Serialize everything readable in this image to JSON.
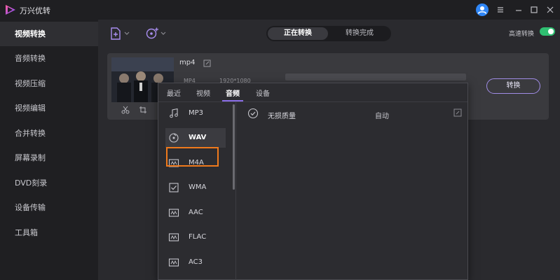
{
  "app": {
    "title": "万兴优转"
  },
  "sidebar": {
    "items": [
      {
        "label": "视频转换",
        "active": true
      },
      {
        "label": "音频转换"
      },
      {
        "label": "视频压缩"
      },
      {
        "label": "视频编辑"
      },
      {
        "label": "合并转换"
      },
      {
        "label": "屏幕录制"
      },
      {
        "label": "DVD刻录"
      },
      {
        "label": "设备传输"
      },
      {
        "label": "工具箱"
      }
    ]
  },
  "toolbar": {
    "tabs": [
      {
        "label": "正在转换",
        "active": true
      },
      {
        "label": "转换完成"
      }
    ],
    "high_speed_label": "高速转换",
    "high_speed_on": true
  },
  "file": {
    "name": "mp4",
    "format": "MP4",
    "resolution": "1920*1080",
    "convert_label": "转换"
  },
  "dropdown": {
    "tabs": [
      {
        "label": "最近"
      },
      {
        "label": "视频"
      },
      {
        "label": "音频",
        "active": true
      },
      {
        "label": "设备"
      }
    ],
    "formats": [
      {
        "label": "MP3",
        "icon": "music-note-icon"
      },
      {
        "label": "WAV",
        "icon": "disc-icon",
        "selected": true
      },
      {
        "label": "M4A",
        "icon": "audio-file-icon"
      },
      {
        "label": "WMA",
        "icon": "check-file-icon"
      },
      {
        "label": "AAC",
        "icon": "audio-file-icon"
      },
      {
        "label": "FLAC",
        "icon": "audio-file-icon"
      },
      {
        "label": "AC3",
        "icon": "audio-file-icon"
      }
    ],
    "quality": {
      "name": "无损质量",
      "value": "自动"
    }
  },
  "colors": {
    "accent": "#8a6ee8",
    "highlight": "#f07a1c",
    "toggle": "#2fbf71"
  }
}
